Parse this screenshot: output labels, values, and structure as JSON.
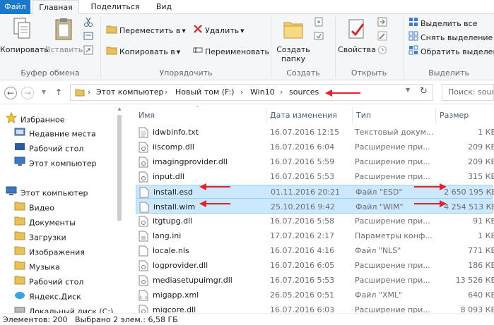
{
  "tabs": {
    "file": "Файл",
    "home": "Главная",
    "share": "Поделиться",
    "view": "Вид"
  },
  "ribbon": {
    "clipboard": {
      "copy": "Копировать",
      "paste": "Вставить",
      "group": "Буфер обмена"
    },
    "organize": {
      "move_to": "Переместить в",
      "copy_to": "Копировать в",
      "delete": "Удалить",
      "rename": "Переименовать",
      "group": "Упорядочить"
    },
    "new": {
      "new_folder_line1": "Создать",
      "new_folder_line2": "папку",
      "group": "Создать"
    },
    "open": {
      "properties": "Свойства",
      "group": "Открыть"
    },
    "select": {
      "select_all": "Выделить все",
      "select_none": "Снять выделение",
      "invert": "Обратить выделение",
      "group": "Выделить"
    }
  },
  "address": {
    "crumbs": [
      "Этот компьютер",
      "Новый том (F:)",
      "Win10",
      "sources"
    ],
    "search_placeholder": "Поиск: sources"
  },
  "nav": {
    "favorites_header": "Избранное",
    "favorites": [
      "Недавние места",
      "Рабочий стол",
      "Этот компьютер"
    ],
    "computer_header": "Этот компьютер",
    "computer": [
      "Видео",
      "Документы",
      "Загрузки",
      "Изображения",
      "Музыка",
      "Рабочий стол",
      "Яндекс.Диск",
      "Локальный диск (C:)"
    ]
  },
  "columns": {
    "name": "Имя",
    "date": "Дата изменения",
    "type": "Тип",
    "size": "Размер"
  },
  "files": [
    {
      "name": "idwbinfo.txt",
      "date": "16.07.2016 12:15",
      "type": "Текстовый докум...",
      "size": "1 КБ",
      "icon": "text-file",
      "selected": false
    },
    {
      "name": "iiscomp.dll",
      "date": "16.07.2016 6:04",
      "type": "Расширение при...",
      "size": "209 КБ",
      "icon": "dll-file",
      "selected": false
    },
    {
      "name": "imagingprovider.dll",
      "date": "16.07.2016 5:59",
      "type": "Расширение при...",
      "size": "209 КБ",
      "icon": "dll-file",
      "selected": false
    },
    {
      "name": "input.dll",
      "date": "16.07.2016 5:53",
      "type": "Расширение при...",
      "size": "315 КБ",
      "icon": "dll-file",
      "selected": false
    },
    {
      "name": "install.esd",
      "date": "01.11.2016 20:21",
      "type": "Файл \"ESD\"",
      "size": "2 650 195 КБ",
      "icon": "blank-file",
      "selected": true
    },
    {
      "name": "install.wim",
      "date": "25.10.2016 9:42",
      "type": "Файл \"WIM\"",
      "size": "4 254 513 КБ",
      "icon": "blank-file",
      "selected": true
    },
    {
      "name": "itgtupg.dll",
      "date": "16.07.2016 5:58",
      "type": "Расширение при...",
      "size": "91 КБ",
      "icon": "dll-file",
      "selected": false
    },
    {
      "name": "lang.ini",
      "date": "17.07.2016 2:17",
      "type": "Параметры конф...",
      "size": "1 КБ",
      "icon": "ini-file",
      "selected": false
    },
    {
      "name": "locale.nls",
      "date": "16.07.2016 4:16",
      "type": "Файл \"NLS\"",
      "size": "771 КБ",
      "icon": "blank-file",
      "selected": false
    },
    {
      "name": "logprovider.dll",
      "date": "16.07.2016 6:05",
      "type": "Расширение при...",
      "size": "186 КБ",
      "icon": "dll-file",
      "selected": false
    },
    {
      "name": "mediasetupuimgr.dll",
      "date": "16.07.2016 5:53",
      "type": "Расширение при...",
      "size": "13 526 КБ",
      "icon": "dll-file",
      "selected": false
    },
    {
      "name": "migapp.xml",
      "date": "26.05.2016 0:51",
      "type": "Файл \"XML\"",
      "size": "640 КБ",
      "icon": "xml-file",
      "selected": false
    },
    {
      "name": "migcore.dll",
      "date": "16.07.2016 6:03",
      "type": "Расширение при...",
      "size": "8 093 КБ",
      "icon": "dll-file",
      "selected": false
    }
  ],
  "status": {
    "items": "Элементов: 200",
    "selected": "Выбрано 2 элем.: 6,58 ГБ"
  },
  "colors": {
    "accent": "#1979ca",
    "selection": "#cce8ff",
    "annotation": "#e8202a"
  }
}
